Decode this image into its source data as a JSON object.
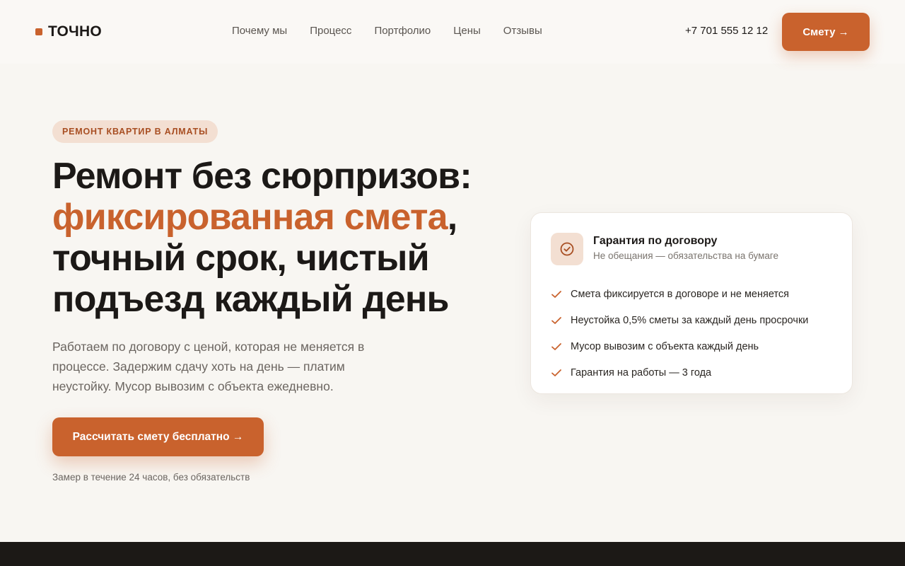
{
  "header": {
    "logo_text": "ТОЧНО",
    "nav": [
      "Почему мы",
      "Процесс",
      "Портфолио",
      "Цены",
      "Отзывы"
    ],
    "phone": "+7 701 555 12 12",
    "cta_label": "Смету →"
  },
  "hero": {
    "tag": "РЕМОНТ КВАРТИР В АЛМАТЫ",
    "headline_line1": "Ремонт без сюрпризов:",
    "headline_accent": "фиксированная смета",
    "headline_comma": ",",
    "headline_line3": "точный срок, чистый",
    "headline_line4": "подъезд каждый день",
    "lead": "Работаем по договору с ценой, которая не меняется в процессе. Задержим сдачу хоть на день — платим неустойку. Мусор вывозим с объекта ежедневно.",
    "cta_label": "Рассчитать смету бесплатно →",
    "note": "Замер в течение 24 часов, без обязательств"
  },
  "card": {
    "icon": "check-circle-icon",
    "title": "Гарантия по договору",
    "subtitle": "Не обещания — обязательства на бумаге",
    "items": [
      "Смета фиксируется в договоре и не меняется",
      "Неустойка 0,5% сметы за каждый день просрочки",
      "Мусор вывозим с объекта каждый день",
      "Гарантия на работы — 3 года"
    ]
  },
  "colors": {
    "accent": "#c9622d",
    "background": "#f8f6f2",
    "text": "#1c1917",
    "footer": "#1c1916"
  }
}
